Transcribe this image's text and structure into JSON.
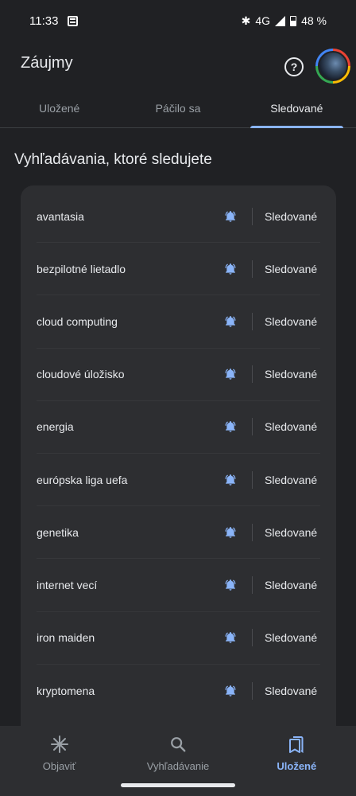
{
  "status_bar": {
    "time": "11:33",
    "network": "4G",
    "battery": "48 %"
  },
  "header": {
    "title": "Záujmy",
    "help_glyph": "?"
  },
  "tabs": [
    {
      "label": "Uložené",
      "active": false
    },
    {
      "label": "Páčilo sa",
      "active": false
    },
    {
      "label": "Sledované",
      "active": true
    }
  ],
  "section": {
    "title": "Vyhľadávania, ktoré sledujete"
  },
  "searches": [
    {
      "label": "avantasia",
      "status": "Sledované"
    },
    {
      "label": "bezpilotné lietadlo",
      "status": "Sledované"
    },
    {
      "label": "cloud computing",
      "status": "Sledované"
    },
    {
      "label": "cloudové úložisko",
      "status": "Sledované"
    },
    {
      "label": "energia",
      "status": "Sledované"
    },
    {
      "label": "európska liga uefa",
      "status": "Sledované"
    },
    {
      "label": "genetika",
      "status": "Sledované"
    },
    {
      "label": "internet vecí",
      "status": "Sledované"
    },
    {
      "label": "iron maiden",
      "status": "Sledované"
    },
    {
      "label": "kryptomena",
      "status": "Sledované"
    }
  ],
  "bottom_nav": [
    {
      "label": "Objaviť",
      "icon": "asterisk-icon",
      "active": false
    },
    {
      "label": "Vyhľadávanie",
      "icon": "search-icon",
      "active": false
    },
    {
      "label": "Uložené",
      "icon": "bookmarks-icon",
      "active": true
    }
  ],
  "colors": {
    "accent": "#8ab4f8",
    "background": "#202124",
    "card": "#2d2e31"
  }
}
